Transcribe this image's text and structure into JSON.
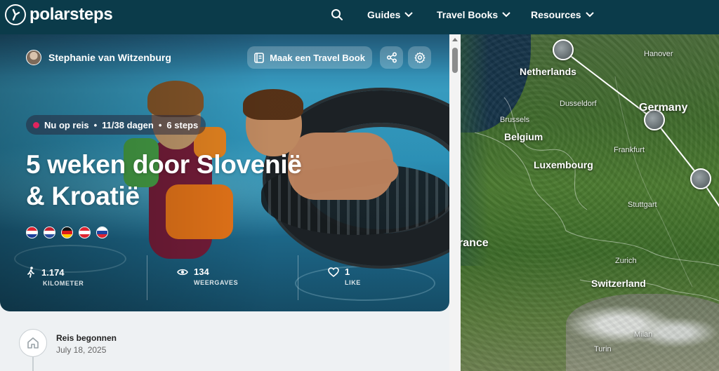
{
  "nav": {
    "logo_text": "polarsteps",
    "items": [
      {
        "label": "Guides"
      },
      {
        "label": "Travel Books"
      },
      {
        "label": "Resources"
      }
    ]
  },
  "trip": {
    "author": "Stephanie van Witzenburg",
    "travel_book_button": "Maak een Travel Book",
    "status": {
      "live_label": "Nu op reis",
      "days": "11/38 dagen",
      "steps": "6 steps",
      "separator": "•"
    },
    "title": "5 weken door Slovenië & Kroatië",
    "flags": [
      {
        "country": "Croatia",
        "colors": [
          "#e0242f",
          "#ffffff",
          "#1a3d9a"
        ]
      },
      {
        "country": "Netherlands",
        "colors": [
          "#c3202f",
          "#ffffff",
          "#2a4fa0"
        ]
      },
      {
        "country": "Germany",
        "colors": [
          "#111111",
          "#dd1c1a",
          "#ffcc00"
        ]
      },
      {
        "country": "Austria",
        "colors": [
          "#e0242f",
          "#ffffff",
          "#e0242f"
        ]
      },
      {
        "country": "Slovenia",
        "colors": [
          "#ffffff",
          "#1f45a6",
          "#e0242f"
        ]
      }
    ],
    "stats": [
      {
        "value": "1.174",
        "label": "KILOMETER",
        "icon": "walker-icon"
      },
      {
        "value": "134",
        "label": "WEERGAVES",
        "icon": "eye-icon"
      },
      {
        "value": "1",
        "label": "LIKE",
        "icon": "heart-icon"
      }
    ]
  },
  "timeline": {
    "title": "Reis begonnen",
    "date": "July 18, 2025"
  },
  "map": {
    "labels": [
      {
        "text": "Hanover",
        "size": "small"
      },
      {
        "text": "Netherlands",
        "size": "mid"
      },
      {
        "text": "Germany",
        "size": "big"
      },
      {
        "text": "Dusseldorf",
        "size": "small"
      },
      {
        "text": "Brussels",
        "size": "small"
      },
      {
        "text": "Belgium",
        "size": "mid"
      },
      {
        "text": "Frankfurt",
        "size": "small"
      },
      {
        "text": "Luxembourg",
        "size": "mid"
      },
      {
        "text": "Stuttgart",
        "size": "small"
      },
      {
        "text": "rance",
        "size": "big"
      },
      {
        "text": "Zurich",
        "size": "small"
      },
      {
        "text": "Switzerland",
        "size": "mid"
      },
      {
        "text": "Milan",
        "size": "small"
      },
      {
        "text": "Turin",
        "size": "small"
      }
    ]
  },
  "colors": {
    "nav_bg": "#0b3b4a",
    "live_dot": "#e0245e"
  }
}
